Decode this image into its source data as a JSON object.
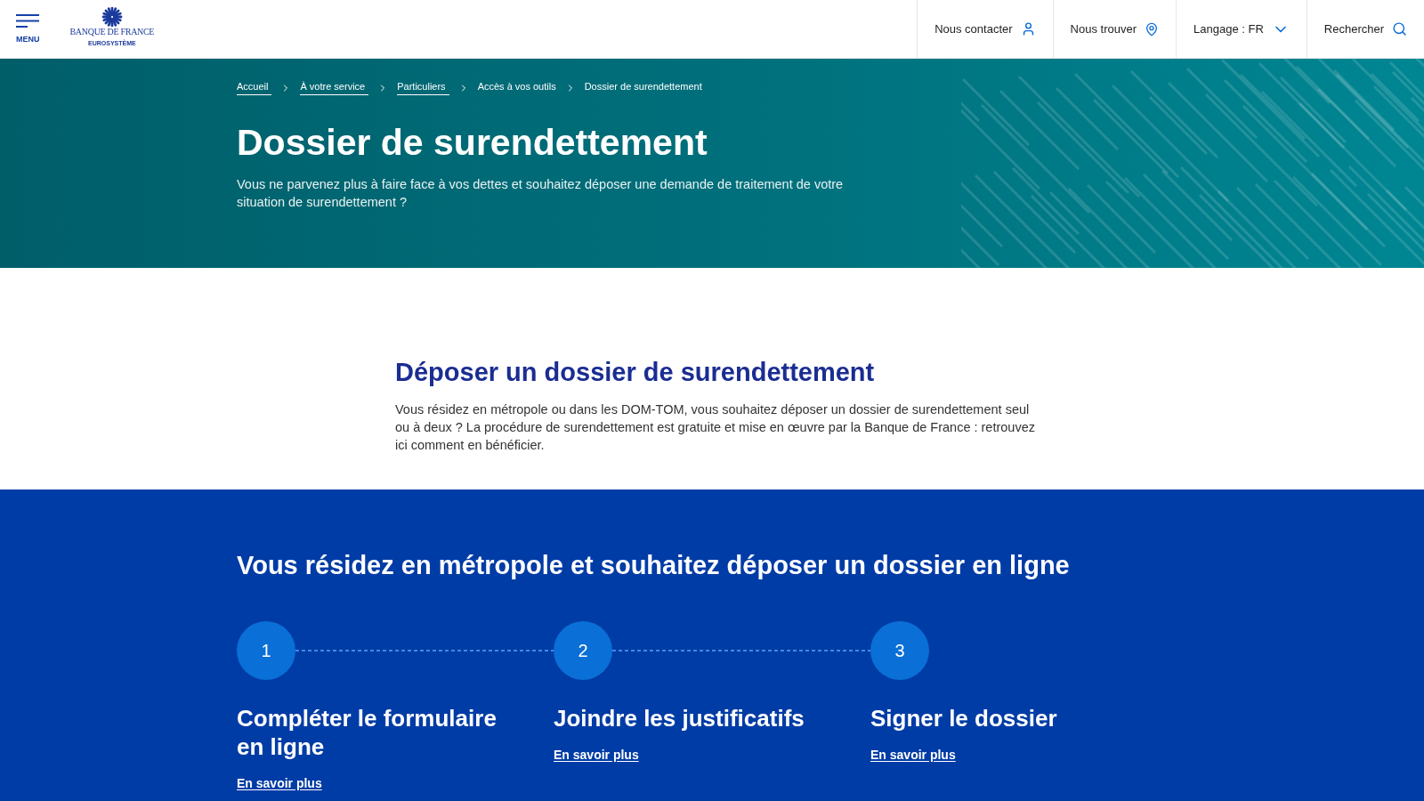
{
  "header": {
    "menu": {
      "label": "MENU"
    },
    "logo": {
      "name": "BANQUE DE FRANCE",
      "tagline": "EUROSYSTÈME"
    },
    "nav": [
      {
        "kind": "contact",
        "label": "Nous contacter"
      },
      {
        "kind": "locate",
        "label": "Nous trouver"
      },
      {
        "kind": "language",
        "label": "Langage : FR"
      },
      {
        "kind": "search",
        "label": "Rechercher"
      }
    ]
  },
  "hero": {
    "breadcrumb": [
      {
        "kind": "link",
        "label": "Accueil"
      },
      {
        "kind": "link",
        "label": "À votre service"
      },
      {
        "kind": "link",
        "label": "Particuliers"
      },
      {
        "kind": "text",
        "label": "Accès à vos outils"
      },
      {
        "kind": "text",
        "label": "Dossier de surendettement"
      }
    ],
    "title": "Dossier de surendettement",
    "description": "Vous ne parvenez plus à faire face à vos dettes et souhaitez déposer une demande de traitement de votre situation de surendettement ?"
  },
  "intro": {
    "title": "Déposer un dossier de surendettement",
    "text": "Vous résidez en métropole ou dans les DOM-TOM, vous souhaitez déposer un dossier de surendettement seul ou à deux ? La procédure de surendettement est gratuite et mise en œuvre par la Banque de France : retrouvez ici comment en bénéficier."
  },
  "online_filing": {
    "title": "Vous résidez en métropole et souhaitez déposer un dossier en ligne",
    "steps": [
      {
        "number": "1",
        "title": "Compléter le formulaire en ligne",
        "link": "En savoir plus"
      },
      {
        "number": "2",
        "title": "Joindre les justificatifs",
        "link": "En savoir plus"
      },
      {
        "number": "3",
        "title": "Signer le dossier",
        "link": "En savoir plus"
      }
    ]
  }
}
